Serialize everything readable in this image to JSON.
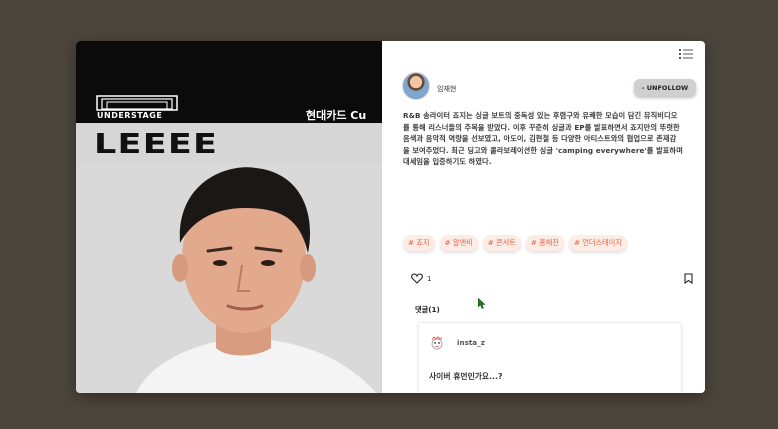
{
  "post": {
    "image": {
      "logo_text": "UNDERSTAGE",
      "banner_text": "현대카드 Cu",
      "artist_name": "LEEEE"
    },
    "author": {
      "username": "임재현",
      "avatar": "profile-avatar"
    },
    "menu_icon": "list-icon",
    "unfollow_label": "- UNFOLLOW",
    "description": "R&B 송라이터 죠지는 싱글 보트의 중독성 있는 후렴구와 유쾌한 모습이 담긴 뮤직비디오를 통해 리스너들의 주목을 받았다. 이후 꾸준히 싱글과 EP를 발표하면서 죠지만의 뚜렷한 음색과 음악적 역량을 선보였고, 아도이, 김현철 등 다양한 아티스트와의 협업으로 존재감을 보여주었다. 최근 딩고와 콜라보레이션한 싱글 'camping everywhere'를 발표하며 대세임을 입증하기도 하였다.",
    "tags": [
      "# 죠지",
      "# 알앤비",
      "# 콘서트",
      "# 홍해찬",
      "# 언더스테이지"
    ],
    "likes": "1",
    "comments_title": "댓글(1)",
    "comments": [
      {
        "user": "insta_z",
        "text": "사이버 휴먼인가요...?"
      }
    ]
  },
  "colors": {
    "background": "#4b453c",
    "tag_bg": "#fdebe5",
    "tag_text": "#e2664a",
    "button_bg": "#cfcfcf"
  }
}
